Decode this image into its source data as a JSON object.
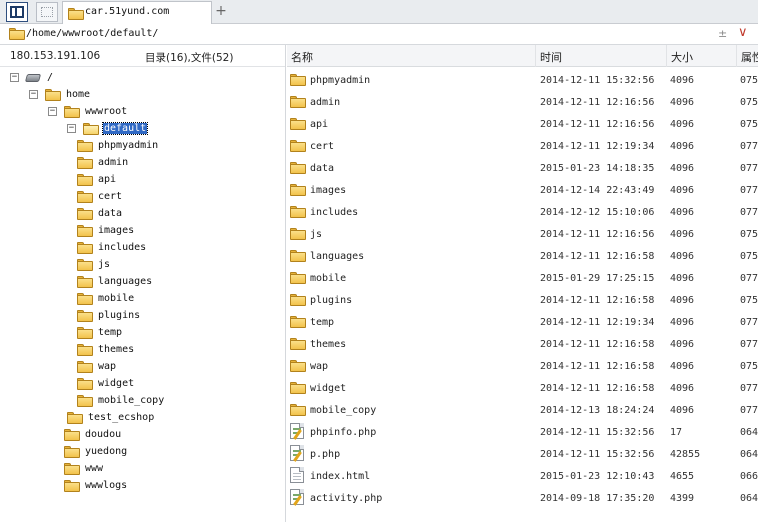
{
  "tabbar": {
    "tab_title": "car.51yund.com",
    "add_tab": "+"
  },
  "address": {
    "path": "/home/wwwroot/default/",
    "action1": "±",
    "action2": "∨"
  },
  "left": {
    "ip": "180.153.191.106",
    "counts": "目录(16),文件(52)",
    "tree": [
      {
        "label": "/",
        "level": 0,
        "expander": "−",
        "icon": "drive"
      },
      {
        "label": "home",
        "level": 1,
        "expander": "−",
        "icon": "folder"
      },
      {
        "label": "wwwroot",
        "level": 2,
        "expander": "−",
        "icon": "folder"
      },
      {
        "label": "default",
        "level": 3,
        "expander": "−",
        "icon": "folder-open",
        "selected": true
      },
      {
        "label": "phpmyadmin",
        "level": 4,
        "icon": "folder"
      },
      {
        "label": "admin",
        "level": 4,
        "icon": "folder"
      },
      {
        "label": "api",
        "level": 4,
        "icon": "folder"
      },
      {
        "label": "cert",
        "level": 4,
        "icon": "folder"
      },
      {
        "label": "data",
        "level": 4,
        "icon": "folder"
      },
      {
        "label": "images",
        "level": 4,
        "icon": "folder"
      },
      {
        "label": "includes",
        "level": 4,
        "icon": "folder"
      },
      {
        "label": "js",
        "level": 4,
        "icon": "folder"
      },
      {
        "label": "languages",
        "level": 4,
        "icon": "folder"
      },
      {
        "label": "mobile",
        "level": 4,
        "icon": "folder"
      },
      {
        "label": "plugins",
        "level": 4,
        "icon": "folder"
      },
      {
        "label": "temp",
        "level": 4,
        "icon": "folder"
      },
      {
        "label": "themes",
        "level": 4,
        "icon": "folder"
      },
      {
        "label": "wap",
        "level": 4,
        "icon": "folder"
      },
      {
        "label": "widget",
        "level": 4,
        "icon": "folder"
      },
      {
        "label": "mobile_copy",
        "level": 4,
        "icon": "folder"
      },
      {
        "label": "test_ecshop",
        "level": 3,
        "icon": "folder"
      },
      {
        "label": "doudou",
        "level": 2,
        "icon": "folder"
      },
      {
        "label": "yuedong",
        "level": 2,
        "icon": "folder"
      },
      {
        "label": "www",
        "level": 2,
        "icon": "folder"
      },
      {
        "label": "wwwlogs",
        "level": 2,
        "icon": "folder"
      }
    ]
  },
  "right": {
    "columns": [
      "名称",
      "时间",
      "大小",
      "属性"
    ],
    "rows": [
      {
        "name": "phpmyadmin",
        "time": "2014-12-11 15:32:56",
        "size": "4096",
        "perm": "075",
        "icon": "folder"
      },
      {
        "name": "admin",
        "time": "2014-12-11 12:16:56",
        "size": "4096",
        "perm": "075",
        "icon": "folder"
      },
      {
        "name": "api",
        "time": "2014-12-11 12:16:56",
        "size": "4096",
        "perm": "075",
        "icon": "folder"
      },
      {
        "name": "cert",
        "time": "2014-12-11 12:19:34",
        "size": "4096",
        "perm": "077",
        "icon": "folder"
      },
      {
        "name": "data",
        "time": "2015-01-23 14:18:35",
        "size": "4096",
        "perm": "077",
        "icon": "folder"
      },
      {
        "name": "images",
        "time": "2014-12-14 22:43:49",
        "size": "4096",
        "perm": "077",
        "icon": "folder"
      },
      {
        "name": "includes",
        "time": "2014-12-12 15:10:06",
        "size": "4096",
        "perm": "077",
        "icon": "folder"
      },
      {
        "name": "js",
        "time": "2014-12-11 12:16:56",
        "size": "4096",
        "perm": "075",
        "icon": "folder"
      },
      {
        "name": "languages",
        "time": "2014-12-11 12:16:58",
        "size": "4096",
        "perm": "075",
        "icon": "folder"
      },
      {
        "name": "mobile",
        "time": "2015-01-29 17:25:15",
        "size": "4096",
        "perm": "077",
        "icon": "folder"
      },
      {
        "name": "plugins",
        "time": "2014-12-11 12:16:58",
        "size": "4096",
        "perm": "075",
        "icon": "folder"
      },
      {
        "name": "temp",
        "time": "2014-12-11 12:19:34",
        "size": "4096",
        "perm": "077",
        "icon": "folder"
      },
      {
        "name": "themes",
        "time": "2014-12-11 12:16:58",
        "size": "4096",
        "perm": "077",
        "icon": "folder"
      },
      {
        "name": "wap",
        "time": "2014-12-11 12:16:58",
        "size": "4096",
        "perm": "075",
        "icon": "folder"
      },
      {
        "name": "widget",
        "time": "2014-12-11 12:16:58",
        "size": "4096",
        "perm": "077",
        "icon": "folder"
      },
      {
        "name": "mobile_copy",
        "time": "2014-12-13 18:24:24",
        "size": "4096",
        "perm": "077",
        "icon": "folder"
      },
      {
        "name": "phpinfo.php",
        "time": "2014-12-11 15:32:56",
        "size": "17",
        "perm": "064",
        "icon": "php"
      },
      {
        "name": "p.php",
        "time": "2014-12-11 15:32:56",
        "size": "42855",
        "perm": "064",
        "icon": "php"
      },
      {
        "name": "index.html",
        "time": "2015-01-23 12:10:43",
        "size": "4655",
        "perm": "066",
        "icon": "html"
      },
      {
        "name": "activity.php",
        "time": "2014-09-18 17:35:20",
        "size": "4399",
        "perm": "064",
        "icon": "php"
      }
    ]
  }
}
